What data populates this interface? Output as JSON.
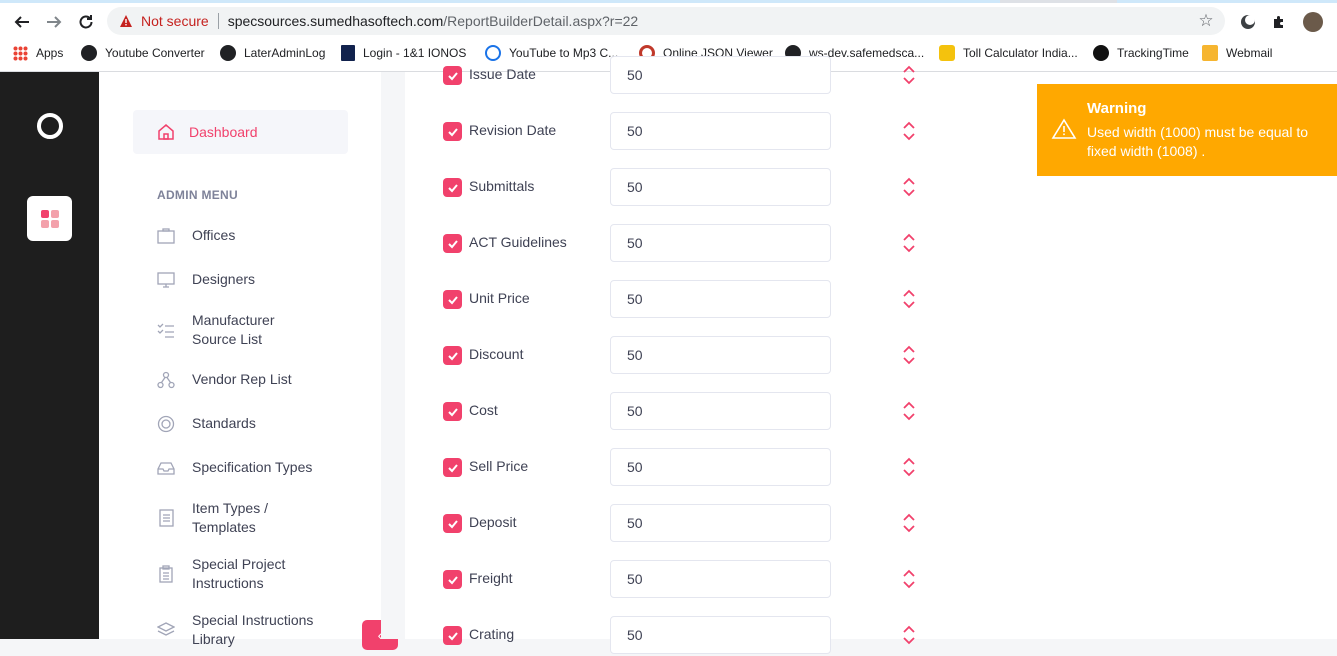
{
  "browser": {
    "security_label": "Not secure",
    "url_host": "specsources.sumedhasoftech.com",
    "url_path": "/ReportBuilderDetail.aspx?r=22",
    "bookmarks": [
      {
        "label": "Apps",
        "icon": "apps-grid-icon"
      },
      {
        "label": "Youtube Converter",
        "icon": "globe-icon"
      },
      {
        "label": "LaterAdminLog",
        "icon": "globe-icon"
      },
      {
        "label": "Login - 1&1 IONOS",
        "icon": "ionos-icon"
      },
      {
        "label": "YouTube to Mp3 C...",
        "icon": "cloud-download-icon"
      },
      {
        "label": "Online JSON Viewer",
        "icon": "json-viewer-icon"
      },
      {
        "label": "ws-dev.safemedsca...",
        "icon": "globe-icon"
      },
      {
        "label": "Toll Calculator India...",
        "icon": "toll-icon"
      },
      {
        "label": "TrackingTime",
        "icon": "tracking-time-icon"
      },
      {
        "label": "Webmail",
        "icon": "mail-icon"
      }
    ]
  },
  "sidebar": {
    "dashboard_label": "Dashboard",
    "menu_heading": "ADMIN MENU",
    "items": [
      {
        "label": "Offices",
        "icon": "briefcase-icon"
      },
      {
        "label": "Designers",
        "icon": "monitor-icon"
      },
      {
        "label": "Manufacturer Source List",
        "icon": "checklist-icon"
      },
      {
        "label": "Vendor Rep List",
        "icon": "people-network-icon"
      },
      {
        "label": "Standards",
        "icon": "target-circle-icon"
      },
      {
        "label": "Specification Types",
        "icon": "inbox-tray-icon"
      },
      {
        "label": "Item Types / Templates",
        "icon": "document-list-icon"
      },
      {
        "label": "Special Project Instructions",
        "icon": "clipboard-icon"
      },
      {
        "label": "Special Instructions Library",
        "icon": "layers-icon"
      }
    ]
  },
  "fields": [
    {
      "label": "Issue Date",
      "value": "50",
      "checked": true
    },
    {
      "label": "Revision Date",
      "value": "50",
      "checked": true
    },
    {
      "label": "Submittals",
      "value": "50",
      "checked": true
    },
    {
      "label": "ACT Guidelines",
      "value": "50",
      "checked": true
    },
    {
      "label": "Unit Price",
      "value": "50",
      "checked": true
    },
    {
      "label": "Discount",
      "value": "50",
      "checked": true
    },
    {
      "label": "Cost",
      "value": "50",
      "checked": true
    },
    {
      "label": "Sell Price",
      "value": "50",
      "checked": true
    },
    {
      "label": "Deposit",
      "value": "50",
      "checked": true
    },
    {
      "label": "Freight",
      "value": "50",
      "checked": true
    },
    {
      "label": "Crating",
      "value": "50",
      "checked": true
    }
  ],
  "toast": {
    "title": "Warning",
    "message": "Used width (1000) must be equal to fixed width (1008) ."
  },
  "colors": {
    "accent": "#f1416c",
    "warning": "#ffa800",
    "rail": "#1e1e1e"
  }
}
